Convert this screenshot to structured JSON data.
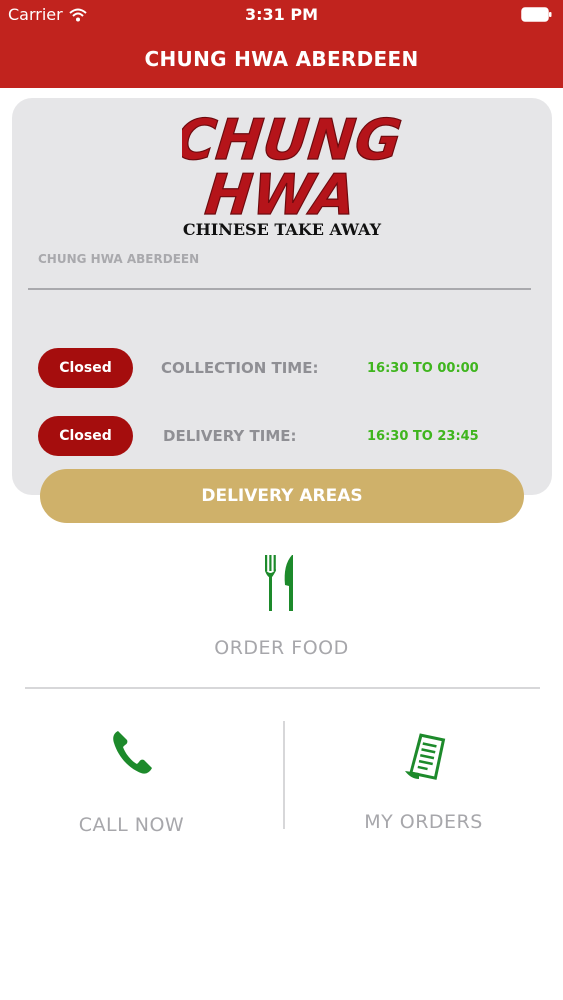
{
  "status_bar": {
    "carrier": "Carrier",
    "time": "3:31 PM",
    "wifi_icon": "wifi-icon",
    "battery_icon": "battery-icon"
  },
  "header": {
    "title": "CHUNG HWA ABERDEEN",
    "color": "#c1231e"
  },
  "logo": {
    "line1": "CHUNG",
    "line2": "HWA",
    "tagline": "CHINESE TAKE AWAY",
    "color": "#b5141a"
  },
  "restaurant": {
    "name": "CHUNG HWA ABERDEEN"
  },
  "hours": [
    {
      "status": "Closed",
      "label": "COLLECTION TIME:",
      "time": "16:30 TO 00:00"
    },
    {
      "status": "Closed",
      "label": "DELIVERY TIME:",
      "time": "16:30 TO 23:45"
    }
  ],
  "delivery_areas_button": {
    "label": "DELIVERY AREAS",
    "color": "#cfb16a"
  },
  "actions": {
    "order_food": {
      "label": "ORDER FOOD",
      "icon": "fork-knife-icon"
    },
    "call_now": {
      "label": "CALL NOW",
      "icon": "phone-icon"
    },
    "my_orders": {
      "label": "MY ORDERS",
      "icon": "receipt-icon"
    }
  },
  "colors": {
    "closed_pill": "#a50d0d",
    "time_green": "#3fb51e",
    "icon_green": "#1d8a2b"
  }
}
